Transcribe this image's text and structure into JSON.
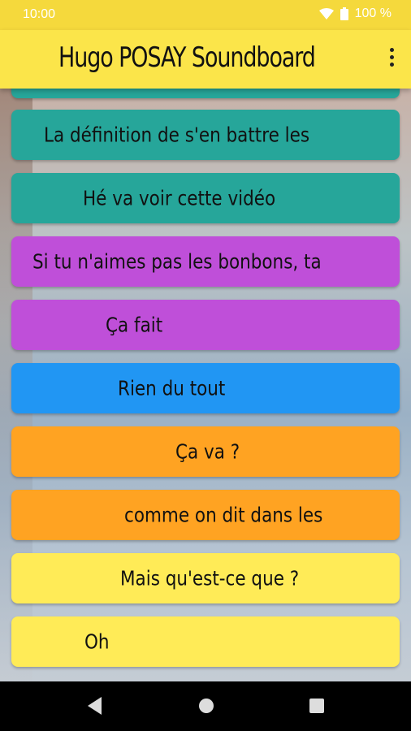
{
  "status": {
    "time": "10:00",
    "battery": "100 %"
  },
  "appbar": {
    "title": "Hugo POSAY Soundboard",
    "menu_icon": "more-vert-icon"
  },
  "buttons": [
    {
      "label": "",
      "color": "#26a69a"
    },
    {
      "label": "La définition de s'en battre les",
      "color": "#26a69a"
    },
    {
      "label": "Hé va voir cette vidéo",
      "color": "#26a69a"
    },
    {
      "label": "Si tu n'aimes pas les bonbons, ta",
      "color": "#bf4fd9"
    },
    {
      "label": "Ça fait",
      "color": "#bf4fd9"
    },
    {
      "label": "Rien du tout",
      "color": "#2196f3"
    },
    {
      "label": "Ça va ?",
      "color": "#ffa322"
    },
    {
      "label": "comme on dit dans les",
      "color": "#ffa322"
    },
    {
      "label": "Mais qu'est-ce que ?",
      "color": "#ffeb57"
    },
    {
      "label": "Oh",
      "color": "#ffeb57"
    }
  ],
  "navbar": {
    "back": "back-icon",
    "home": "home-icon",
    "recents": "recents-icon"
  }
}
